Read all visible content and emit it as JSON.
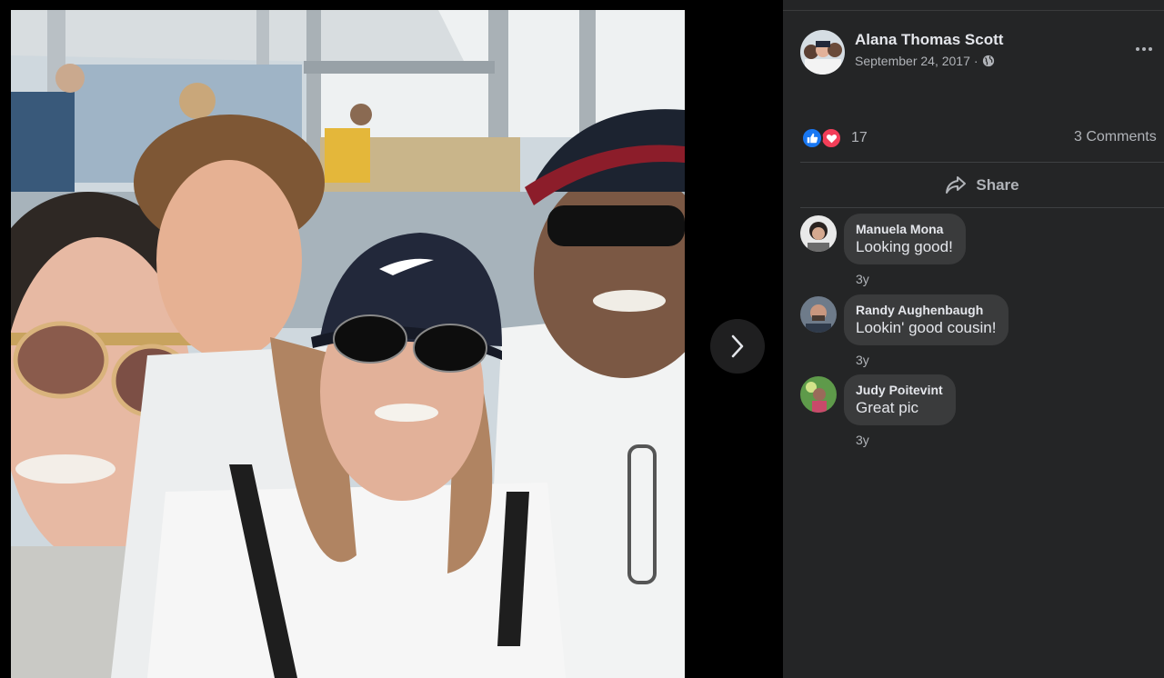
{
  "post": {
    "author": "Alana Thomas Scott",
    "date": "September 24, 2017",
    "separator": "·",
    "privacy_icon": "globe-icon",
    "more_icon": "more-horizontal-icon"
  },
  "reactions": {
    "icons": [
      "like-icon",
      "love-icon"
    ],
    "count": "17",
    "comments_label": "3 Comments"
  },
  "actions": {
    "share_label": "Share",
    "share_icon": "share-icon"
  },
  "viewer": {
    "next_icon": "chevron-right-icon"
  },
  "comments": [
    {
      "author": "Manuela Mona",
      "text": "Looking good!",
      "time": "3y"
    },
    {
      "author": "Randy Aughenbaugh",
      "text": "Lookin' good cousin!",
      "time": "3y"
    },
    {
      "author": "Judy Poitevint",
      "text": "Great pic",
      "time": "3y"
    }
  ],
  "colors": {
    "panel_bg": "#242526",
    "bubble_bg": "#3a3b3c",
    "primary_text": "#e4e6eb",
    "secondary_text": "#b0b3b8",
    "like_blue": "#1877f2",
    "love_red": "#f33e58"
  }
}
